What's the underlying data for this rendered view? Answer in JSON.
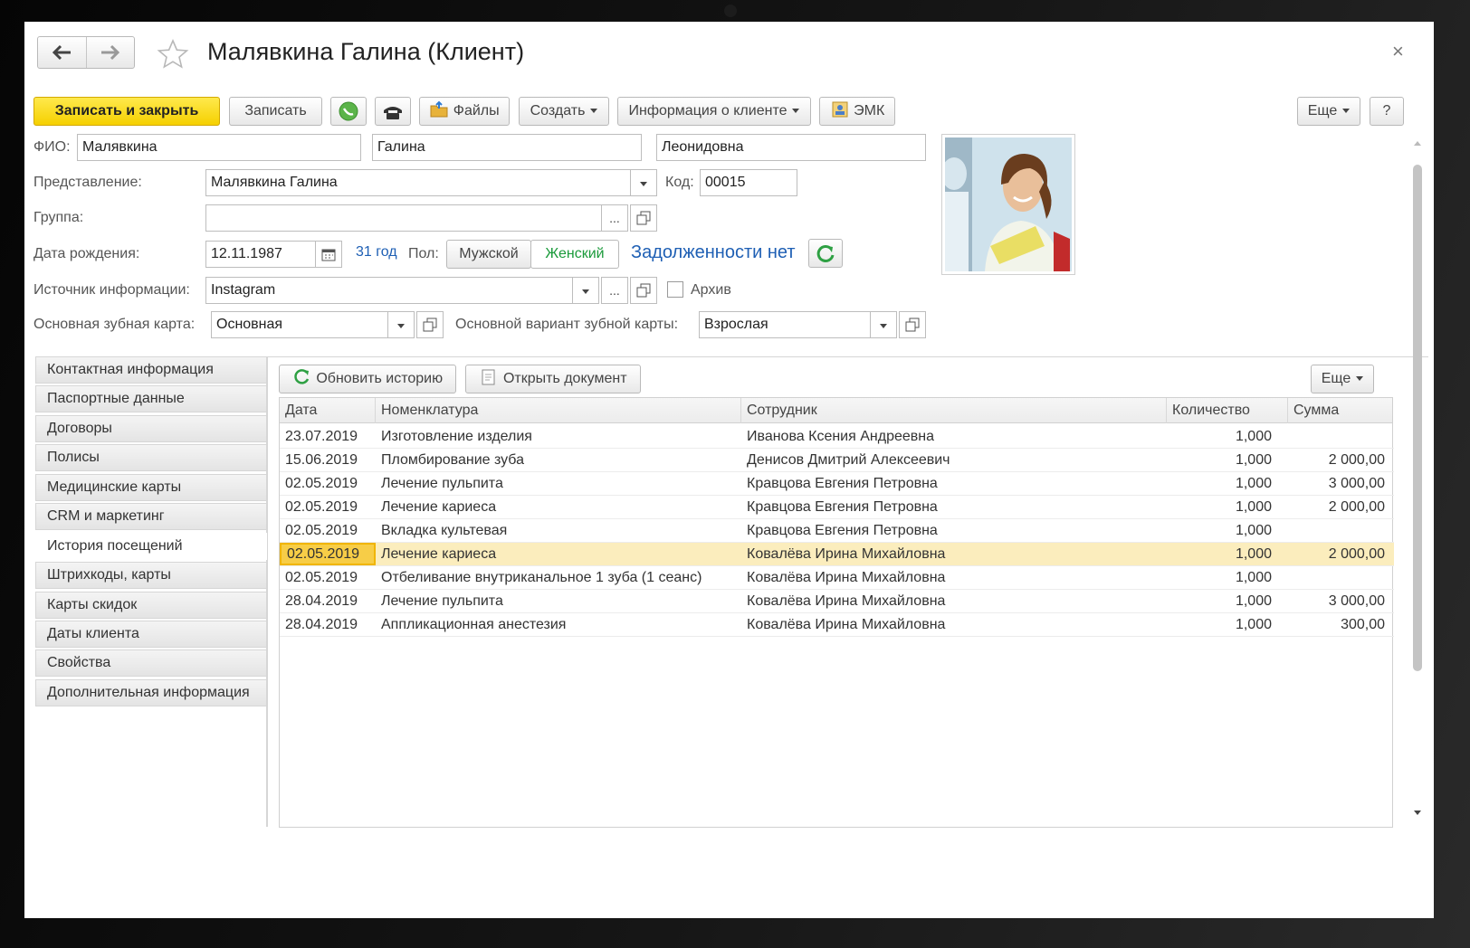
{
  "window": {
    "title": "Малявкина Галина (Клиент)"
  },
  "toolbar": {
    "save_close": "Записать и закрыть",
    "save": "Записать",
    "files": "Файлы",
    "create": "Создать",
    "client_info": "Информация о клиенте",
    "emk": "ЭМК",
    "more": "Еще",
    "help": "?"
  },
  "form": {
    "fio_label": "ФИО:",
    "last_name": "Малявкина",
    "first_name": "Галина",
    "middle_name": "Леонидовна",
    "presentation_label": "Представление:",
    "presentation": "Малявкина Галина",
    "code_label": "Код:",
    "code": "00015",
    "group_label": "Группа:",
    "group": "",
    "birth_label": "Дата рождения:",
    "birth_date": "12.11.1987",
    "age": "31 год",
    "gender_label": "Пол:",
    "gender_male": "Мужской",
    "gender_female": "Женский",
    "debt_status": "Задолженности нет",
    "source_label": "Источник информации:",
    "source": "Instagram",
    "archive_label": "Архив",
    "dental_card_label": "Основная зубная карта:",
    "dental_card": "Основная",
    "dental_variant_label": "Основной вариант зубной карты:",
    "dental_variant": "Взрослая",
    "ellipsis": "..."
  },
  "sidebar": {
    "items": [
      {
        "label": "Контактная информация"
      },
      {
        "label": "Паспортные данные"
      },
      {
        "label": "Договоры"
      },
      {
        "label": "Полисы"
      },
      {
        "label": "Медицинские карты"
      },
      {
        "label": "CRM и маркетинг"
      },
      {
        "label": "История посещений"
      },
      {
        "label": "Штрихкоды, карты"
      },
      {
        "label": "Карты скидок"
      },
      {
        "label": "Даты клиента"
      },
      {
        "label": "Свойства"
      },
      {
        "label": "Дополнительная информация"
      }
    ],
    "active_index": 6
  },
  "history": {
    "refresh_label": "Обновить историю",
    "open_doc_label": "Открыть документ",
    "more_label": "Еще",
    "columns": [
      "Дата",
      "Номенклатура",
      "Сотрудник",
      "Количество",
      "Сумма"
    ],
    "rows": [
      {
        "date": "23.07.2019",
        "item": "Изготовление изделия",
        "employee": "Иванова Ксения Андреевна",
        "qty": "1,000",
        "sum": ""
      },
      {
        "date": "15.06.2019",
        "item": "Пломбирование зуба",
        "employee": "Денисов Дмитрий Алексеевич",
        "qty": "1,000",
        "sum": "2 000,00"
      },
      {
        "date": "02.05.2019",
        "item": "Лечение пульпита",
        "employee": "Кравцова Евгения Петровна",
        "qty": "1,000",
        "sum": "3 000,00"
      },
      {
        "date": "02.05.2019",
        "item": "Лечение кариеса",
        "employee": "Кравцова Евгения Петровна",
        "qty": "1,000",
        "sum": "2 000,00"
      },
      {
        "date": "02.05.2019",
        "item": "Вкладка культевая",
        "employee": "Кравцова Евгения Петровна",
        "qty": "1,000",
        "sum": ""
      },
      {
        "date": "02.05.2019",
        "item": "Лечение кариеса",
        "employee": "Ковалёва Ирина Михайловна",
        "qty": "1,000",
        "sum": "2 000,00"
      },
      {
        "date": "02.05.2019",
        "item": "Отбеливание внутриканальное 1 зуба (1 сеанс)",
        "employee": "Ковалёва Ирина Михайловна",
        "qty": "1,000",
        "sum": ""
      },
      {
        "date": "28.04.2019",
        "item": "Лечение пульпита",
        "employee": "Ковалёва Ирина Михайловна",
        "qty": "1,000",
        "sum": "3 000,00"
      },
      {
        "date": "28.04.2019",
        "item": "Аппликационная анестезия",
        "employee": "Ковалёва Ирина Михайловна",
        "qty": "1,000",
        "sum": "300,00"
      }
    ],
    "selected_row": 5
  },
  "colors": {
    "primary_button": "#f5d000",
    "link": "#1e5fb4",
    "female_active": "#1a9a3a",
    "selected_row": "#fbedbd"
  }
}
